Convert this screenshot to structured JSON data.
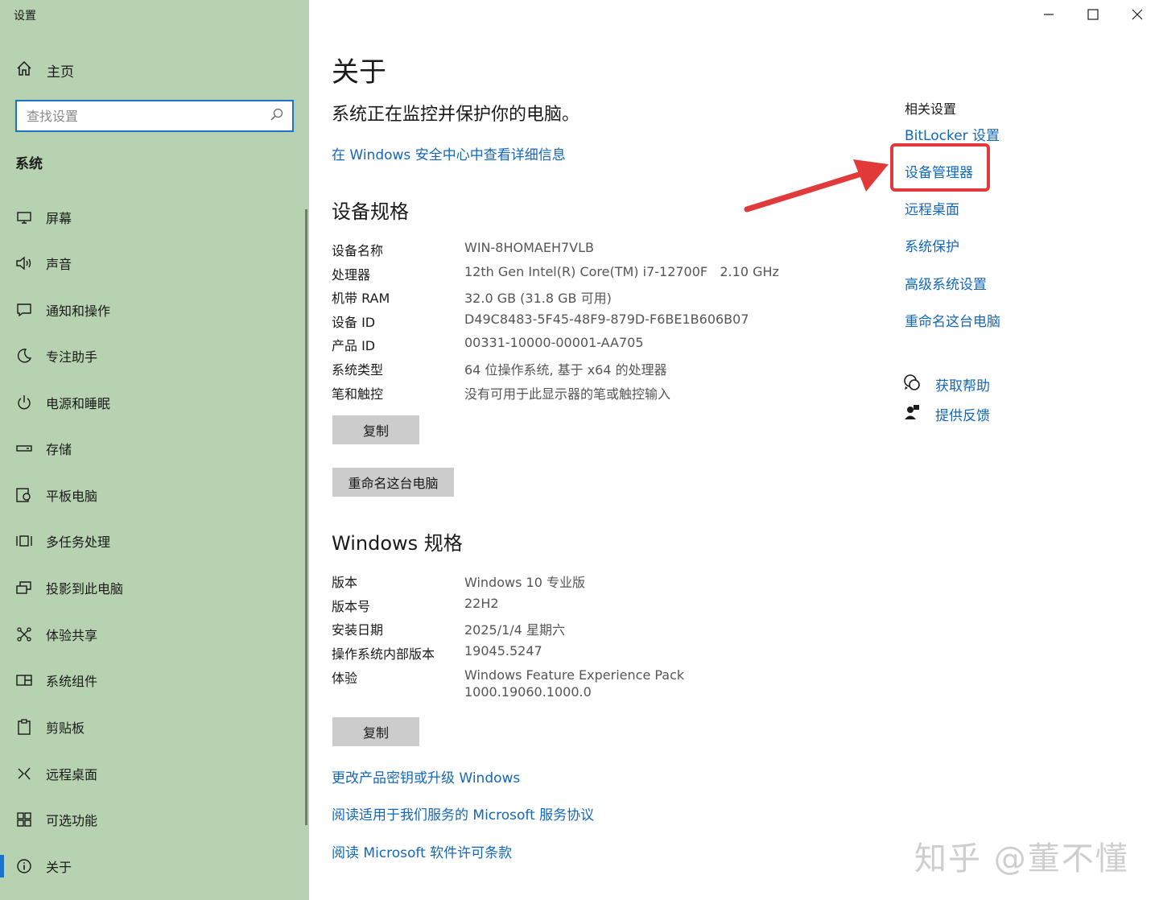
{
  "app": {
    "title": "设置"
  },
  "sidebar": {
    "home_label": "主页",
    "search_placeholder": "查找设置",
    "section_title": "系统",
    "items": [
      {
        "label": "屏幕",
        "icon": "monitor-icon"
      },
      {
        "label": "声音",
        "icon": "speaker-icon"
      },
      {
        "label": "通知和操作",
        "icon": "message-icon"
      },
      {
        "label": "专注助手",
        "icon": "moon-icon"
      },
      {
        "label": "电源和睡眠",
        "icon": "power-icon"
      },
      {
        "label": "存储",
        "icon": "drive-icon"
      },
      {
        "label": "平板电脑",
        "icon": "tablet-icon"
      },
      {
        "label": "多任务处理",
        "icon": "multitask-icon"
      },
      {
        "label": "投影到此电脑",
        "icon": "project-icon"
      },
      {
        "label": "体验共享",
        "icon": "share-icon"
      },
      {
        "label": "系统组件",
        "icon": "components-icon"
      },
      {
        "label": "剪贴板",
        "icon": "clipboard-icon"
      },
      {
        "label": "远程桌面",
        "icon": "remote-icon"
      },
      {
        "label": "可选功能",
        "icon": "grid-icon"
      },
      {
        "label": "关于",
        "icon": "info-icon",
        "active": true
      }
    ]
  },
  "main": {
    "title": "关于",
    "status": "系统正在监控并保护你的电脑。",
    "security_link": "在 Windows 安全中心中查看详细信息",
    "device_spec_title": "设备规格",
    "device_specs": [
      {
        "k": "设备名称",
        "v": "WIN-8HOMAEH7VLB"
      },
      {
        "k": "处理器",
        "v": "12th Gen Intel(R) Core(TM) i7-12700F   2.10 GHz"
      },
      {
        "k": "机带 RAM",
        "v": "32.0 GB (31.8 GB 可用)"
      },
      {
        "k": "设备 ID",
        "v": "D49C8483-5F45-48F9-879D-F6BE1B606B07"
      },
      {
        "k": "产品 ID",
        "v": "00331-10000-00001-AA705"
      },
      {
        "k": "系统类型",
        "v": "64 位操作系统, 基于 x64 的处理器"
      },
      {
        "k": "笔和触控",
        "v": "没有可用于此显示器的笔或触控输入"
      }
    ],
    "copy_label": "复制",
    "rename_label": "重命名这台电脑",
    "windows_spec_title": "Windows 规格",
    "windows_specs": [
      {
        "k": "版本",
        "v": "Windows 10 专业版"
      },
      {
        "k": "版本号",
        "v": "22H2"
      },
      {
        "k": "安装日期",
        "v": "2025/1/4 星期六"
      },
      {
        "k": "操作系统内部版本",
        "v": "19045.5247"
      },
      {
        "k": "体验",
        "v": "Windows Feature Experience Pack",
        "v2": "1000.19060.1000.0"
      }
    ],
    "copy2_label": "复制",
    "links": [
      "更改产品密钥或升级 Windows",
      "阅读适用于我们服务的 Microsoft 服务协议",
      "阅读 Microsoft 软件许可条款"
    ]
  },
  "related": {
    "title": "相关设置",
    "links": [
      "BitLocker 设置",
      "设备管理器",
      "远程桌面",
      "系统保护",
      "高级系统设置",
      "重命名这台电脑"
    ],
    "help": "获取帮助",
    "feedback": "提供反馈"
  },
  "watermark": "知乎 @董不懂",
  "colors": {
    "sidebar_bg": "#b7d2b0",
    "accent": "#1467b8",
    "annotation": "#e23a3a"
  }
}
